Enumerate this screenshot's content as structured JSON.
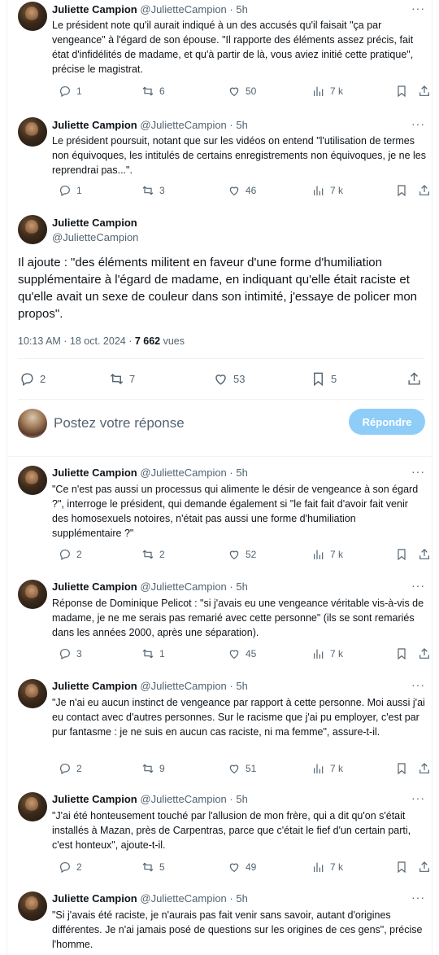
{
  "author": {
    "name": "Juliette Campion",
    "handle": "@JulietteCampion"
  },
  "time_ago": "5h",
  "more_icon": "···",
  "replies_above": [
    {
      "text": "Le président note qu'il aurait indiqué à un des accusés qu'il faisait \"ça par vengeance\" à l'égard de son épouse. \"Il rapporte des éléments assez précis, fait état d'infidélités de madame, et qu'à partir de là, vous aviez initié cette pratique\", précise le magistrat.",
      "reply": "1",
      "retweet": "6",
      "like": "50",
      "views": "7 k"
    },
    {
      "text": "Le président poursuit, notant que sur les vidéos on entend \"l'utilisation de termes non équivoques, les intitulés de certains enregistrements non équivoques, je ne les reprendrai pas...\".",
      "reply": "1",
      "retweet": "3",
      "like": "46",
      "views": "7 k"
    }
  ],
  "main_tweet": {
    "text": "Il ajoute : \"des éléments militent en faveur d'une forme d'humiliation supplémentaire à l'égard de madame, en indiquant qu'elle était raciste et qu'elle avait un sexe de couleur dans son intimité, j'essaye de policer mon propos\".",
    "time": "10:13 AM · 18 oct. 2024 · ",
    "views_count": "7 662",
    "views_label": " vues",
    "reply": "2",
    "retweet": "7",
    "like": "53",
    "bookmark": "5"
  },
  "composer": {
    "placeholder": "Postez votre réponse",
    "button": "Répondre"
  },
  "replies_below": [
    {
      "text": "\"Ce n'est pas aussi un processus qui alimente le désir de vengeance à son égard ?\", interroge le président, qui demande également si \"le fait fait d'avoir fait venir des homosexuels notoires, n'était pas aussi une forme d'humiliation supplémentaire ?\"",
      "reply": "2",
      "retweet": "2",
      "like": "52",
      "views": "7 k"
    },
    {
      "text": "Réponse de Dominique Pelicot : \"si j'avais eu une vengeance véritable vis-à-vis de madame, je ne me serais pas remarié avec cette personne\" (ils se sont remariés dans les années 2000, après une séparation).",
      "reply": "3",
      "retweet": "1",
      "like": "45",
      "views": "7 k"
    },
    {
      "text": "\"Je n'ai eu aucun instinct de vengeance par rapport à cette personne. Moi aussi j'ai eu contact avec d'autres personnes. Sur le racisme que j'ai pu employer, c'est par pur fantasme : je ne suis en aucun cas raciste, ni ma femme\", assure-t-il.",
      "reply": "2",
      "retweet": "9",
      "like": "51",
      "views": "7 k"
    },
    {
      "text": "\"J'ai été honteusement touché par l'allusion de mon frère, qui a dit qu'on s'était installés à Mazan, près de Carpentras, parce que c'était le fief d'un certain parti, c'est honteux\", ajoute-t-il.",
      "reply": "2",
      "retweet": "5",
      "like": "49",
      "views": "7 k"
    },
    {
      "text": "\"Si j'avais été raciste, je n'aurais pas fait venir sans savoir, autant d'origines différentes. Je n'ai jamais posé de questions sur les origines de ces gens\", précise l'homme."
    }
  ],
  "icons": [
    "reply-icon",
    "retweet-icon",
    "like-icon",
    "views-icon",
    "bookmark-icon",
    "share-icon",
    "more-icon"
  ]
}
